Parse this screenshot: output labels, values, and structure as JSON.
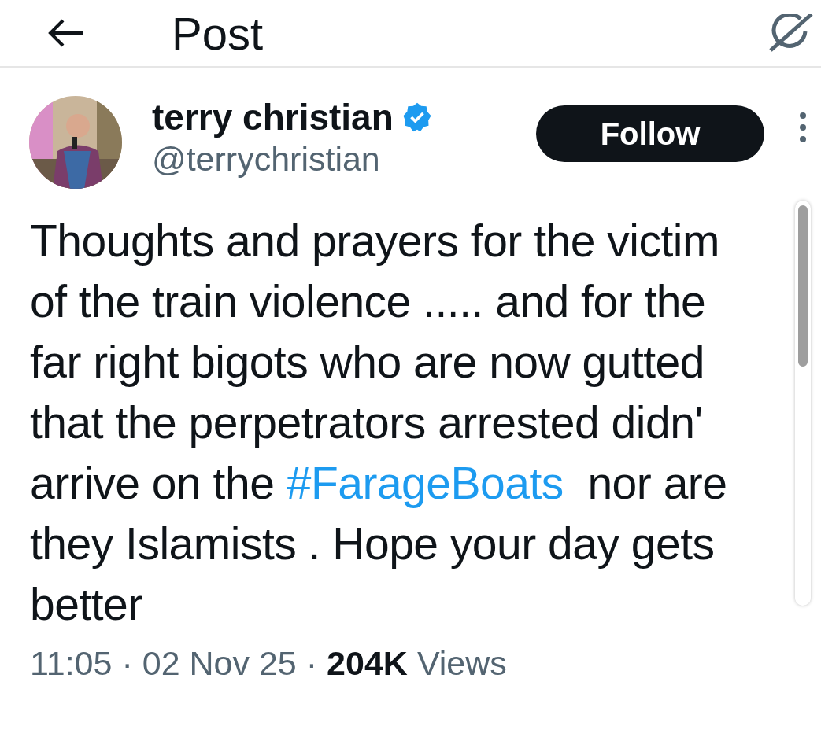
{
  "header": {
    "title": "Post"
  },
  "author": {
    "name": "terry christian",
    "verified": true,
    "handle": "@terrychristian"
  },
  "follow_button": {
    "label": "Follow"
  },
  "post": {
    "segments": [
      {
        "kind": "text",
        "text": "Thoughts and prayers for the victim\nof the train violence ..... and for the\nfar right bigots who are now gutted\nthat the perpetrators arrested didn'\narrive on the "
      },
      {
        "kind": "hashtag",
        "text": "#FarageBoats"
      },
      {
        "kind": "text",
        "text": "  nor are\nthey Islamists . Hope your day gets\nbetter"
      }
    ]
  },
  "meta": [
    {
      "kind": "muted",
      "text": "11:05"
    },
    {
      "kind": "muted",
      "text": "·"
    },
    {
      "kind": "muted",
      "text": "02 Nov 25"
    },
    {
      "kind": "muted",
      "text": "·"
    },
    {
      "kind": "strong",
      "text": "204K"
    },
    {
      "kind": "muted",
      "text": "Views"
    }
  ]
}
